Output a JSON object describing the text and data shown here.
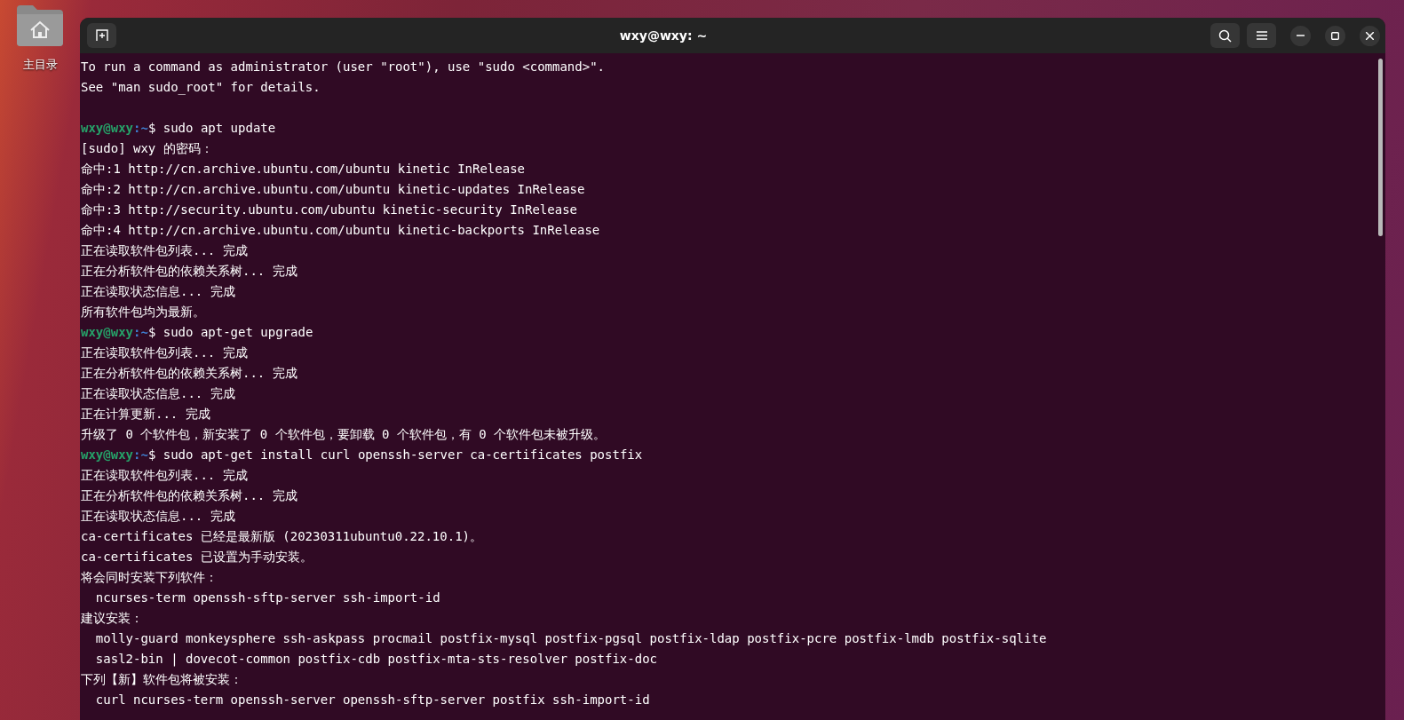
{
  "desktop": {
    "icons": [
      {
        "label": "主目录"
      }
    ]
  },
  "window": {
    "title": "wxy@wxy: ~"
  },
  "terminal": {
    "lines": [
      {
        "kind": "output",
        "text": "To run a command as administrator (user \"root\"), use \"sudo <command>\"."
      },
      {
        "kind": "output",
        "text": "See \"man sudo_root\" for details."
      },
      {
        "kind": "blank"
      },
      {
        "kind": "prompt",
        "user": "wxy@wxy",
        "path": ":~",
        "symbol": "$",
        "command": "sudo apt update"
      },
      {
        "kind": "output",
        "text": "[sudo] wxy 的密码："
      },
      {
        "kind": "output",
        "text": "命中:1 http://cn.archive.ubuntu.com/ubuntu kinetic InRelease"
      },
      {
        "kind": "output",
        "text": "命中:2 http://cn.archive.ubuntu.com/ubuntu kinetic-updates InRelease"
      },
      {
        "kind": "output",
        "text": "命中:3 http://security.ubuntu.com/ubuntu kinetic-security InRelease"
      },
      {
        "kind": "output",
        "text": "命中:4 http://cn.archive.ubuntu.com/ubuntu kinetic-backports InRelease"
      },
      {
        "kind": "output",
        "text": "正在读取软件包列表... 完成"
      },
      {
        "kind": "output",
        "text": "正在分析软件包的依赖关系树... 完成"
      },
      {
        "kind": "output",
        "text": "正在读取状态信息... 完成"
      },
      {
        "kind": "output",
        "text": "所有软件包均为最新。"
      },
      {
        "kind": "prompt",
        "user": "wxy@wxy",
        "path": ":~",
        "symbol": "$",
        "command": "sudo apt-get upgrade"
      },
      {
        "kind": "output",
        "text": "正在读取软件包列表... 完成"
      },
      {
        "kind": "output",
        "text": "正在分析软件包的依赖关系树... 完成"
      },
      {
        "kind": "output",
        "text": "正在读取状态信息... 完成"
      },
      {
        "kind": "output",
        "text": "正在计算更新... 完成"
      },
      {
        "kind": "output",
        "text": "升级了 0 个软件包，新安装了 0 个软件包，要卸载 0 个软件包，有 0 个软件包未被升级。"
      },
      {
        "kind": "prompt",
        "user": "wxy@wxy",
        "path": ":~",
        "symbol": "$",
        "command": "sudo apt-get install curl openssh-server ca-certificates postfix"
      },
      {
        "kind": "output",
        "text": "正在读取软件包列表... 完成"
      },
      {
        "kind": "output",
        "text": "正在分析软件包的依赖关系树... 完成"
      },
      {
        "kind": "output",
        "text": "正在读取状态信息... 完成"
      },
      {
        "kind": "output",
        "text": "ca-certificates 已经是最新版 (20230311ubuntu0.22.10.1)。"
      },
      {
        "kind": "output",
        "text": "ca-certificates 已设置为手动安装。"
      },
      {
        "kind": "output",
        "text": "将会同时安装下列软件："
      },
      {
        "kind": "output",
        "text": "  ncurses-term openssh-sftp-server ssh-import-id"
      },
      {
        "kind": "output",
        "text": "建议安装："
      },
      {
        "kind": "output",
        "text": "  molly-guard monkeysphere ssh-askpass procmail postfix-mysql postfix-pgsql postfix-ldap postfix-pcre postfix-lmdb postfix-sqlite"
      },
      {
        "kind": "output",
        "text": "  sasl2-bin | dovecot-common postfix-cdb postfix-mta-sts-resolver postfix-doc"
      },
      {
        "kind": "output",
        "text": "下列【新】软件包将被安装："
      },
      {
        "kind": "output",
        "text": "  curl ncurses-term openssh-server openssh-sftp-server postfix ssh-import-id"
      }
    ]
  }
}
